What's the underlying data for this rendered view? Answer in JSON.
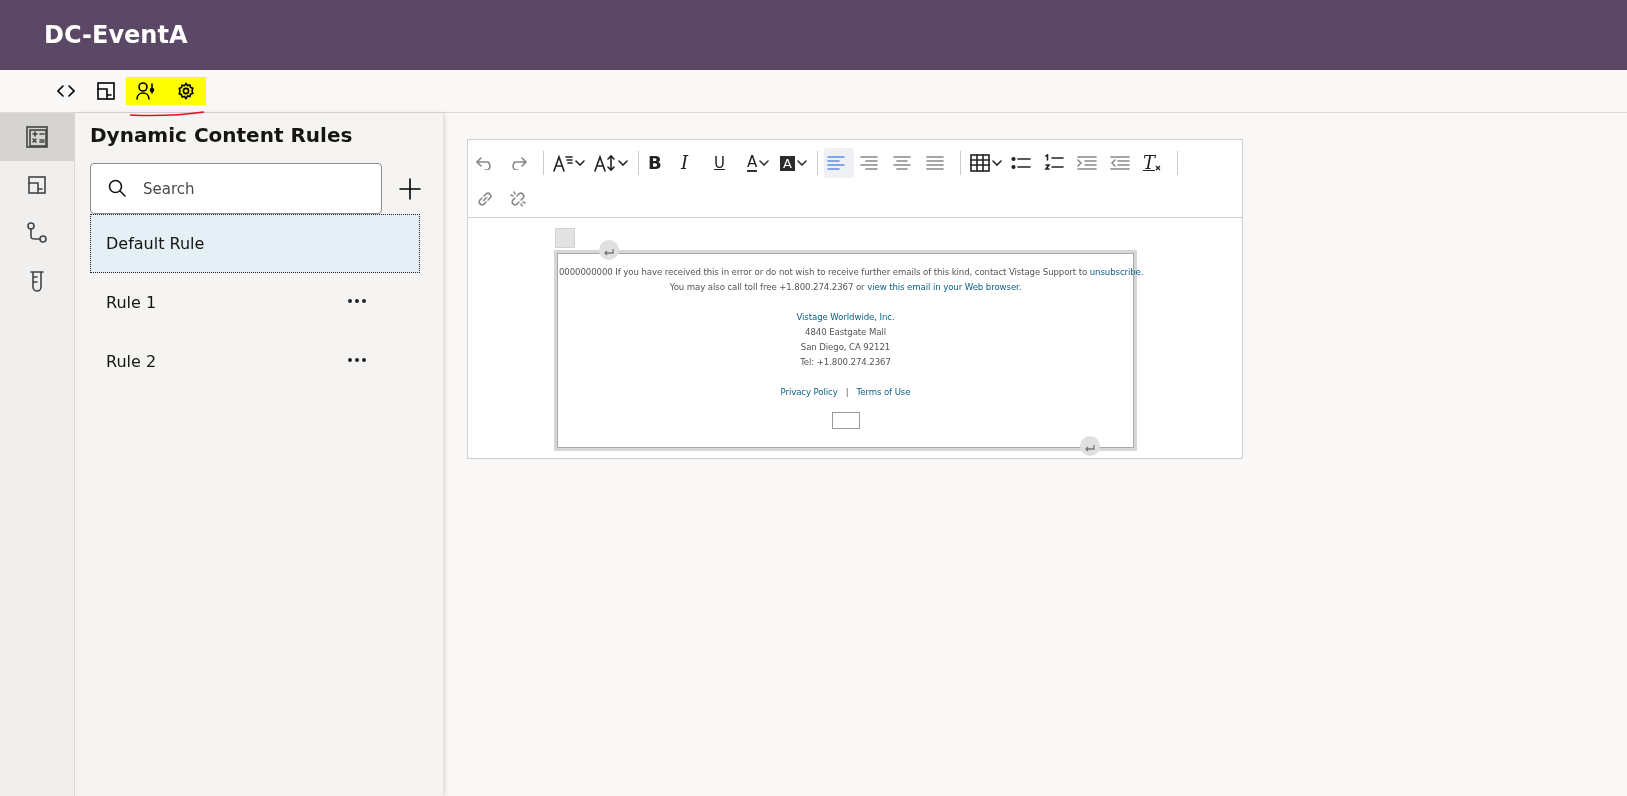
{
  "app": {
    "title": "DC-EventA"
  },
  "top_tools": [
    {
      "kind": "code",
      "highlighted": false
    },
    {
      "kind": "layout",
      "highlighted": false
    },
    {
      "kind": "people",
      "highlighted": true
    },
    {
      "kind": "gear",
      "highlighted": true
    }
  ],
  "rail": [
    {
      "kind": "calc",
      "selected": true
    },
    {
      "kind": "layout",
      "selected": false
    },
    {
      "kind": "branch",
      "selected": false
    },
    {
      "kind": "tube",
      "selected": false
    }
  ],
  "panel": {
    "title": "Dynamic Content Rules",
    "search": {
      "placeholder": "Search"
    },
    "rules": [
      {
        "label": "Default Rule",
        "selected": true,
        "menu": false
      },
      {
        "label": "Rule 1",
        "selected": false,
        "menu": true
      },
      {
        "label": "Rule 2",
        "selected": false,
        "menu": true
      }
    ]
  },
  "editor_toolbar": [
    [
      {
        "kind": "undo"
      },
      {
        "kind": "redo"
      },
      {
        "kind": "sep"
      },
      {
        "kind": "fontsize",
        "dropdown": true
      },
      {
        "kind": "lineheight",
        "dropdown": true
      },
      {
        "kind": "sep"
      },
      {
        "kind": "bold",
        "glyph": "B"
      },
      {
        "kind": "italic",
        "glyph": "I"
      },
      {
        "kind": "underline",
        "glyph": "U"
      },
      {
        "kind": "color",
        "glyph": "A",
        "dropdown": true
      },
      {
        "kind": "fill",
        "glyph": "A",
        "dropdown": true
      },
      {
        "kind": "sep"
      },
      {
        "kind": "align-left",
        "selected": true
      },
      {
        "kind": "align-right",
        "selected": false
      },
      {
        "kind": "align-center",
        "selected": false
      },
      {
        "kind": "align-justify",
        "selected": false
      },
      {
        "kind": "sep"
      },
      {
        "kind": "table",
        "dropdown": true
      },
      {
        "kind": "bullets"
      },
      {
        "kind": "numbers"
      },
      {
        "kind": "indent"
      },
      {
        "kind": "outdent"
      },
      {
        "kind": "clear",
        "glyph": "T"
      },
      {
        "kind": "sep"
      }
    ],
    [
      {
        "kind": "link"
      },
      {
        "kind": "unlink"
      }
    ]
  ],
  "email": {
    "notice": [
      [
        {
          "text": "0000000000 If you have received this in error or do not wish to receive further emails of this kind, contact Vistage Support to ",
          "link": false
        },
        {
          "text": "unsubscribe.",
          "link": true
        }
      ],
      [
        {
          "text": "You may also call toll free +1.800.274.2367 or ",
          "link": false
        },
        {
          "text": "view this email in your Web browser.",
          "link": true
        }
      ]
    ],
    "company": "Vistage Worldwide, Inc.",
    "address": [
      "4840 Eastgate Mall",
      "San Diego, CA 92121",
      "Tel: +1.800.274.2367"
    ],
    "links": [
      "Privacy Policy",
      "Terms of Use"
    ],
    "separator": "|"
  }
}
